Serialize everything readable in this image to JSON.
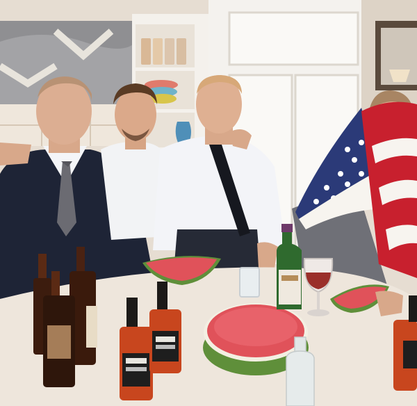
{
  "scene": {
    "colors": {
      "wall": "#ece7df",
      "cabinet": "#f6f4f0",
      "table": "#eee6dc",
      "suit": "#1e2436",
      "shirt": "#f4f5f8",
      "skin": "#d8a88a",
      "watermelon_flesh": "#e0525a",
      "watermelon_rind": "#5f8f3a",
      "flag_red": "#c8202e",
      "flag_blue": "#2b3a78",
      "bottle_amber": "#c8461e",
      "wine_bottle": "#2f6a2e"
    }
  }
}
